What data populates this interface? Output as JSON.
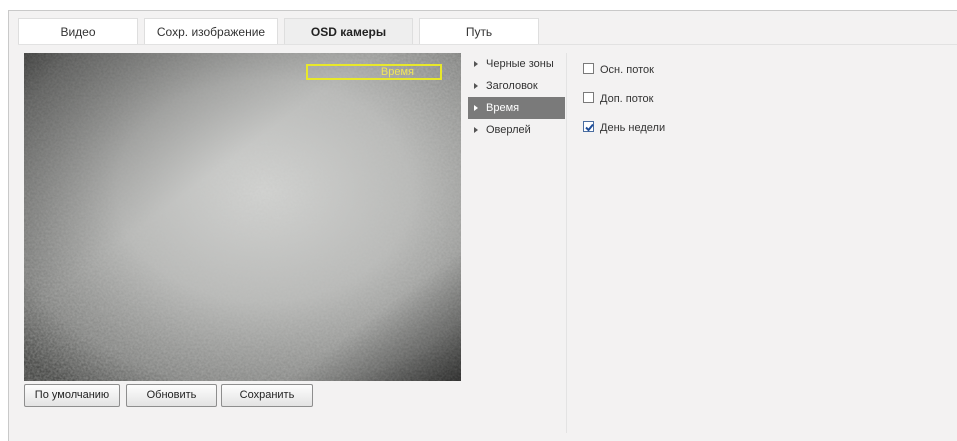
{
  "tabs": [
    {
      "label": "Видео",
      "active": false
    },
    {
      "label": "Сохр. изображение",
      "active": false
    },
    {
      "label": "OSD камеры",
      "active": true
    },
    {
      "label": "Путь",
      "active": false
    }
  ],
  "preview": {
    "osd_label": "Время"
  },
  "buttons": {
    "default_label": "По умолчанию",
    "refresh_label": "Обновить",
    "save_label": "Сохранить"
  },
  "menu": {
    "items": [
      {
        "label": "Черные зоны",
        "active": false
      },
      {
        "label": "Заголовок",
        "active": false
      },
      {
        "label": "Время",
        "active": true
      },
      {
        "label": "Оверлей",
        "active": false
      }
    ]
  },
  "options": [
    {
      "label": "Осн. поток",
      "checked": false
    },
    {
      "label": "Доп. поток",
      "checked": false
    },
    {
      "label": "День недели",
      "checked": true
    }
  ],
  "colors": {
    "osd_outline": "#e8e82a",
    "active_menu": "#7a7a7a",
    "checkmark": "#1f4e9a"
  }
}
